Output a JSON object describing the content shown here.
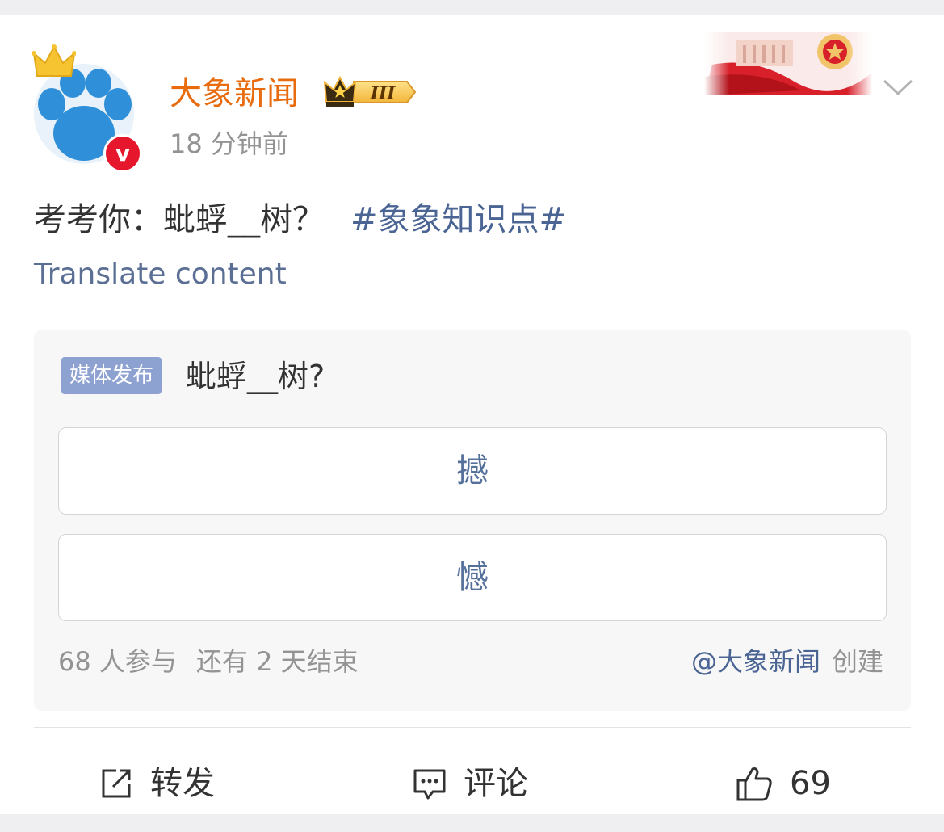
{
  "post": {
    "author_name": "大象新闻",
    "level_badge": "III",
    "time": "18 分钟前",
    "verified_mark": "v",
    "text_main": "考考你：蚍蜉__树？",
    "hashtag": "#象象知识点#",
    "translate_label": "Translate content"
  },
  "poll": {
    "tag": "媒体发布",
    "question": "蚍蜉__树?",
    "options": [
      {
        "label": "撼"
      },
      {
        "label": "憾"
      }
    ],
    "participants": "68 人参与",
    "deadline": "还有 2 天结束",
    "creator": "@大象新闻",
    "created_label": "创建"
  },
  "actions": {
    "repost_label": "转发",
    "comment_label": "评论",
    "like_count": "69"
  },
  "colors": {
    "author_name": "#e86b0e",
    "link": "#4a6594",
    "poll_tag_bg": "#8ea2d2",
    "verified": "#e6162d"
  },
  "icons": {
    "avatar": "paw-avatar",
    "crown": "crown-icon",
    "verified": "verified-icon",
    "level": "crown-level-icon",
    "more": "chevron-down-icon",
    "repost": "share-icon",
    "comment": "comment-icon",
    "like": "thumbs-up-icon"
  }
}
